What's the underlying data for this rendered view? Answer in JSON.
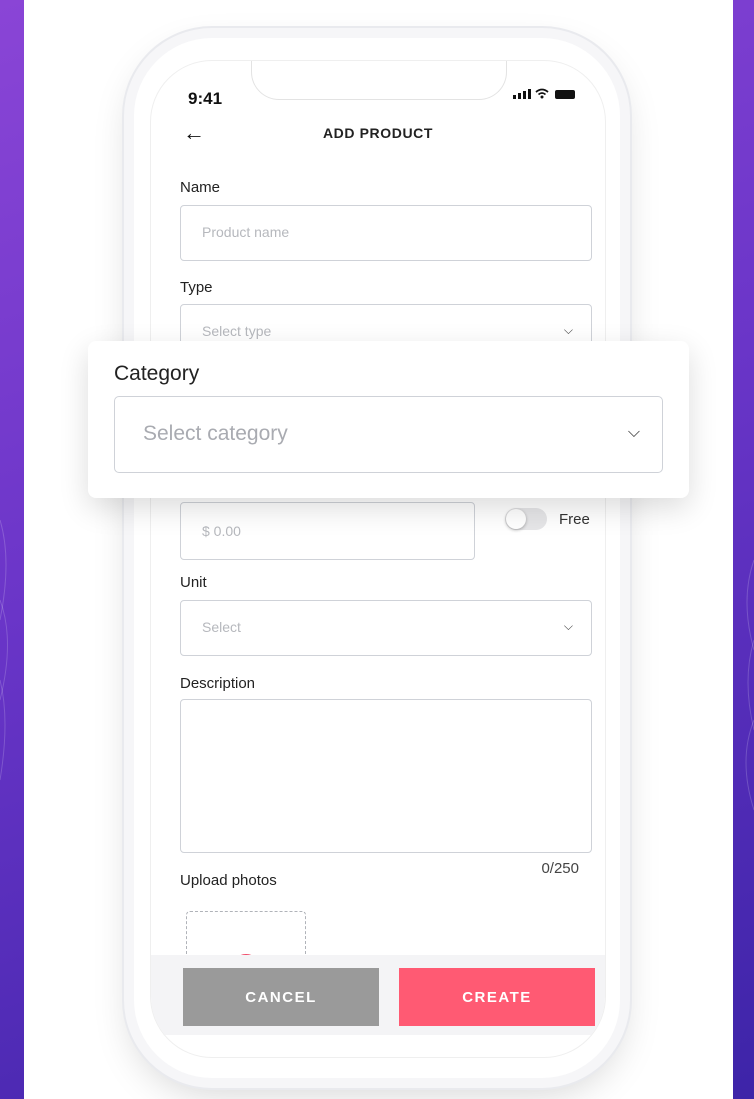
{
  "status": {
    "time": "9:41"
  },
  "header": {
    "title": "ADD PRODUCT"
  },
  "form": {
    "name": {
      "label": "Name",
      "placeholder": "Product name"
    },
    "type": {
      "label": "Type",
      "placeholder": "Select type"
    },
    "category": {
      "label": "Category",
      "placeholder": "Select category"
    },
    "price": {
      "placeholder": "$ 0.00",
      "free_label": "Free",
      "free_enabled": false
    },
    "unit": {
      "label": "Unit",
      "placeholder": "Select"
    },
    "description": {
      "label": "Description",
      "counter": "0/250"
    },
    "upload": {
      "label": "Upload photos"
    }
  },
  "actions": {
    "cancel": "CANCEL",
    "create": "CREATE"
  },
  "colors": {
    "accent": "#ff5a73",
    "cancel": "#9a9a9a",
    "background_gradient": [
      "#8a45d6",
      "#3d24a8"
    ]
  },
  "icons": [
    "back-arrow-icon",
    "chevron-down-icon",
    "signal-icon",
    "wifi-icon",
    "battery-icon",
    "add-photo-icon"
  ]
}
